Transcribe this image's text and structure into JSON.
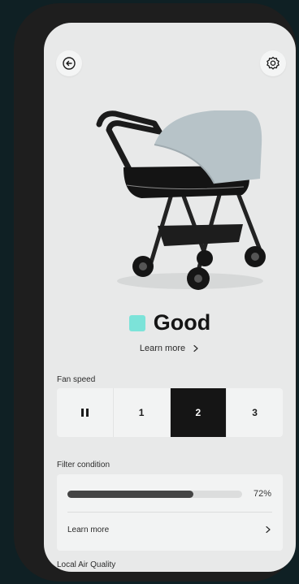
{
  "status": {
    "label": "Good",
    "color": "#7ce3d9"
  },
  "learn_more_top": "Learn more",
  "fan": {
    "label": "Fan speed",
    "options": [
      "1",
      "2",
      "3"
    ],
    "selected": "2"
  },
  "filter": {
    "label": "Filter condition",
    "percent_text": "72%",
    "level": 0.72,
    "learn_more": "Learn more"
  },
  "air_quality": {
    "label": "Local Air Quality"
  },
  "icons": {
    "back": "back-arrow-circle-icon",
    "settings": "gear-icon",
    "pause": "pause-icon",
    "chevron": "chevron-right-icon"
  }
}
